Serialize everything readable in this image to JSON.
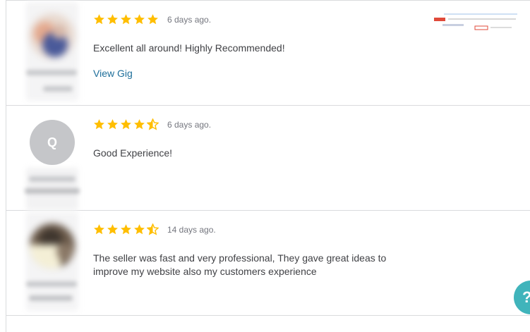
{
  "reviews": [
    {
      "rating": 5,
      "date": "6 days ago.",
      "text": "Excellent all around! Highly Recommended!",
      "link_label": "View Gig"
    },
    {
      "rating": 4.5,
      "avatar_letter": "Q",
      "date": "6 days ago.",
      "text": "Good Experience!"
    },
    {
      "rating": 4.5,
      "date": "14 days ago.",
      "text": "The seller was fast and very professional, They gave great ideas to improve my website also my customers experience"
    }
  ],
  "help": {
    "icon": "help-icon",
    "glyph": "?"
  },
  "colors": {
    "star": "#ffbe00",
    "link": "#1d6e9a",
    "help_bubble": "#40b4bb",
    "border": "#dadbdd"
  }
}
